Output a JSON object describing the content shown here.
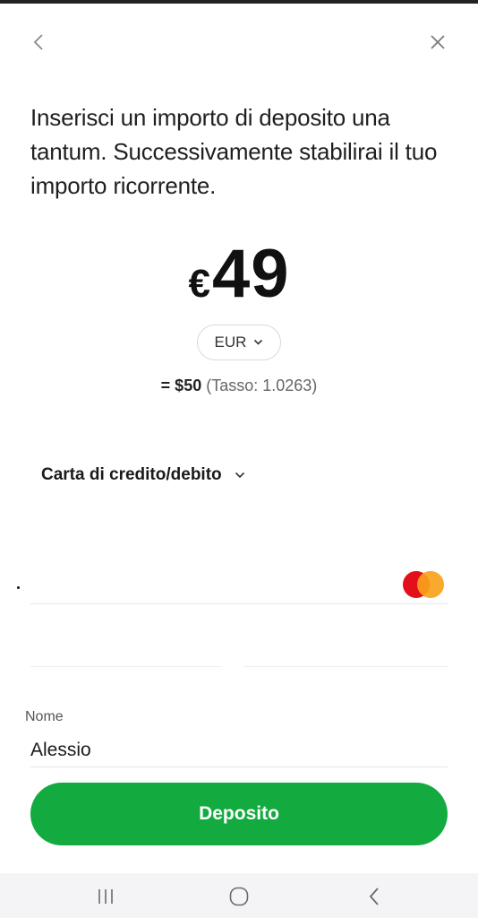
{
  "header": {
    "back_icon": "chevron-left-icon",
    "close_icon": "close-icon"
  },
  "heading": "Inserisci un importo di deposito una tantum. Successivamente stabilirai il tuo importo ricorrente.",
  "amount": {
    "currency_symbol": "€",
    "value": "49"
  },
  "currency_selector": {
    "value": "EUR",
    "icon": "chevron-down-icon"
  },
  "conversion": {
    "prefix": "= $50",
    "rate": "(Tasso: 1.0263)"
  },
  "payment_method": {
    "label": "Carta di credito/debito",
    "icon": "chevron-down-icon"
  },
  "card": {
    "brand_icon": "mastercard-icon",
    "brand_colors": [
      "#e30f1c",
      "#f9a21a"
    ]
  },
  "name_field": {
    "label": "Nome",
    "value": "Alessio"
  },
  "deposit_button": {
    "label": "Deposito",
    "color": "#13ab3f"
  },
  "system_nav": {
    "recents_icon": "recents-icon",
    "home_icon": "home-icon",
    "back_icon": "back-icon"
  }
}
